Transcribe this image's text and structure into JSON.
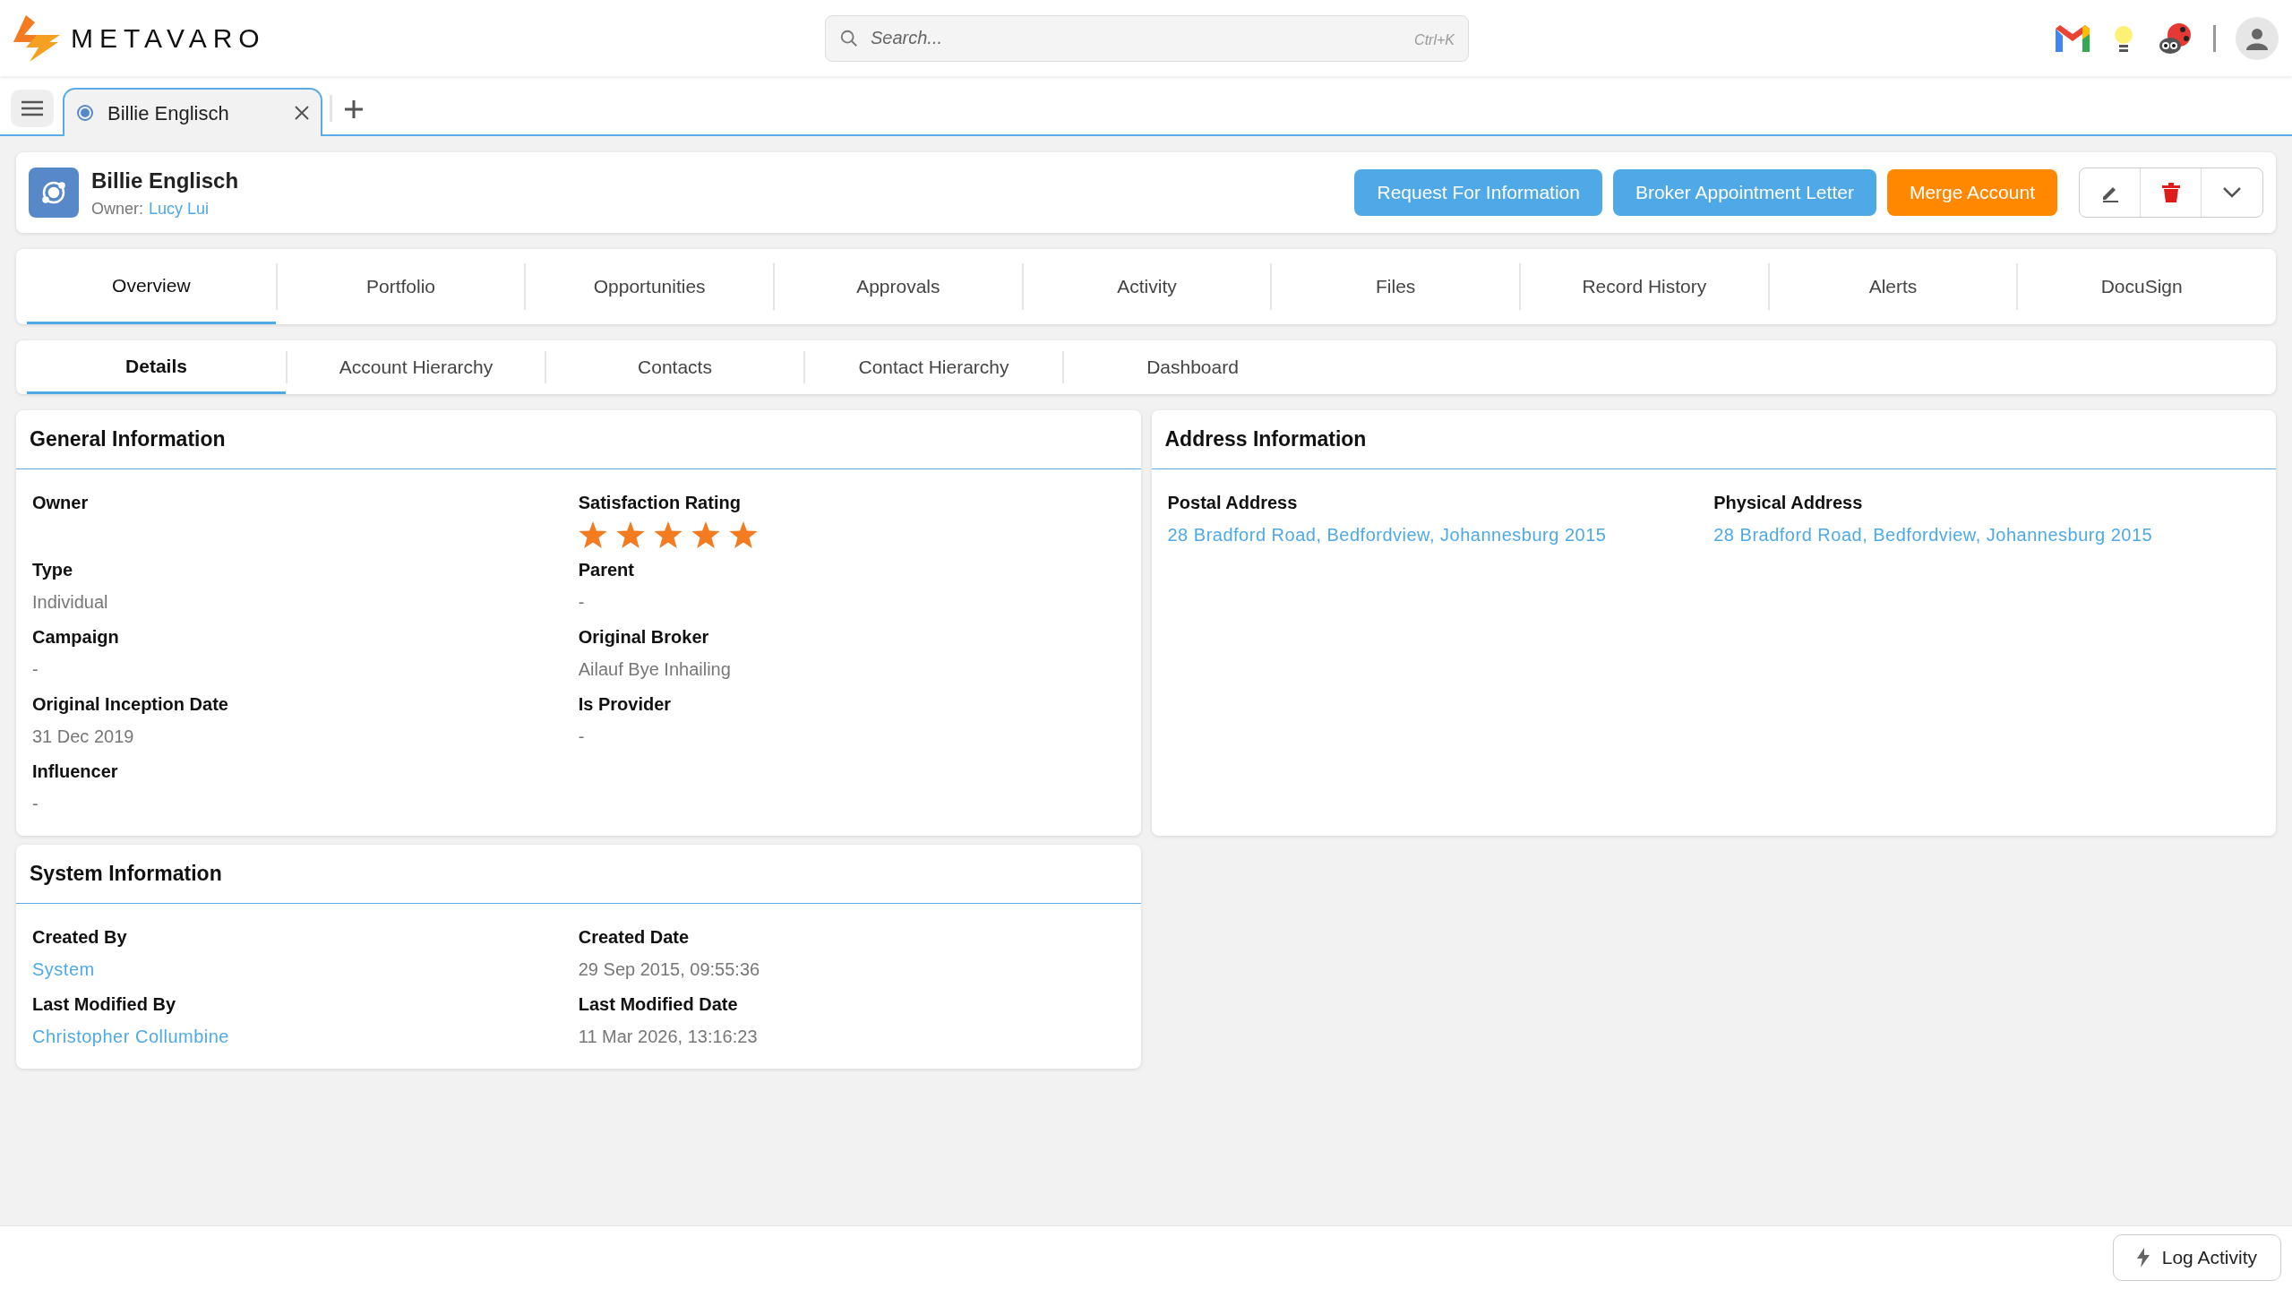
{
  "top_bar": {
    "logo": "METAVARO",
    "search": {
      "placeholder": "Search...",
      "shortcut": "Ctrl+K"
    }
  },
  "tab_strip": {
    "tabs": [
      {
        "label": "Billie Englisch",
        "selected": true
      }
    ]
  },
  "record_header": {
    "name": "Billie Englisch",
    "owner_label": "Owner:",
    "owner": "Lucy Lui",
    "actions": [
      {
        "label": "Request For Information",
        "kind": "primary"
      },
      {
        "label": "Broker Appointment Letter",
        "kind": "primary"
      },
      {
        "label": "Merge Account",
        "kind": "accent"
      }
    ]
  },
  "main_tabs": [
    {
      "label": "Overview",
      "selected": true
    },
    {
      "label": "Portfolio",
      "selected": false
    },
    {
      "label": "Opportunities",
      "selected": false
    },
    {
      "label": "Approvals",
      "selected": false
    },
    {
      "label": "Activity",
      "selected": false
    },
    {
      "label": "Files",
      "selected": false
    },
    {
      "label": "Record History",
      "selected": false
    },
    {
      "label": "Alerts",
      "selected": false
    },
    {
      "label": "DocuSign",
      "selected": false
    }
  ],
  "sub_tabs": [
    {
      "label": "Details",
      "selected": true
    },
    {
      "label": "Account Hierarchy",
      "selected": false
    },
    {
      "label": "Contacts",
      "selected": false
    },
    {
      "label": "Contact Hierarchy",
      "selected": false
    },
    {
      "label": "Dashboard",
      "selected": false
    }
  ],
  "sections": [
    {
      "title": "General Information",
      "fields": [
        {
          "label": "Owner",
          "kind": "text"
        },
        {
          "label": "Satisfaction Rating",
          "kind": "stars",
          "stars": 5
        },
        {
          "label": "Type",
          "kind": "text",
          "value": "Individual"
        },
        {
          "label": "Parent",
          "kind": "text",
          "value": "-"
        },
        {
          "label": "Campaign",
          "kind": "text",
          "value": "-"
        },
        {
          "label": "Original Broker",
          "kind": "text",
          "value": "Ailauf Bye Inhailing"
        },
        {
          "label": "Original Inception Date",
          "kind": "text",
          "value": "31 Dec 2019"
        },
        {
          "label": "Is Provider",
          "kind": "text",
          "value": "-"
        },
        {
          "label": "Influencer",
          "kind": "text",
          "value": "-"
        }
      ]
    },
    {
      "title": "Address Information",
      "fields": [
        {
          "label": "Postal Address",
          "kind": "link",
          "value": "28 Bradford Road, Bedfordview, Johannesburg 2015"
        },
        {
          "label": "Physical Address",
          "kind": "link",
          "value": "28 Bradford Road, Bedfordview, Johannesburg 2015"
        }
      ]
    },
    {
      "title": "System Information",
      "fields": [
        {
          "label": "Created By",
          "kind": "link",
          "value": "System"
        },
        {
          "label": "Created Date",
          "kind": "text",
          "value": "29 Sep 2015, 09:55:36"
        },
        {
          "label": "Last Modified By",
          "kind": "link",
          "value": "Christopher Collumbine"
        },
        {
          "label": "Last Modified Date",
          "kind": "text",
          "value": "11 Mar 2026, 13:16:23"
        }
      ]
    }
  ],
  "footer": {
    "button": "Log Activity"
  }
}
